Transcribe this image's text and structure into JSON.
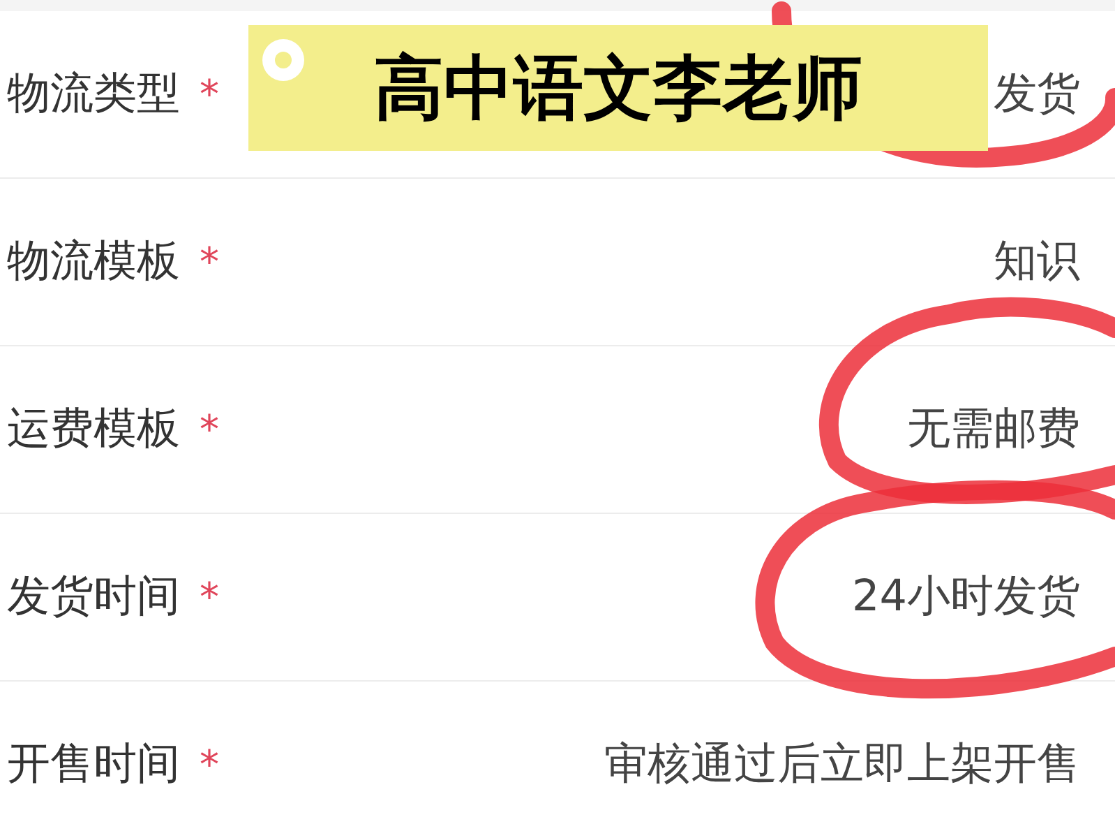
{
  "banner": {
    "text": "高中语文李老师"
  },
  "rows": [
    {
      "label": "物流类型",
      "required_mark": "*",
      "value": "发货"
    },
    {
      "label": "物流模板",
      "required_mark": "*",
      "value": "知识"
    },
    {
      "label": "运费模板",
      "required_mark": "*",
      "value": "无需邮费"
    },
    {
      "label": "发货时间",
      "required_mark": "*",
      "value": "24小时发货"
    },
    {
      "label": "开售时间",
      "required_mark": "*",
      "value": "审核通过后立即上架开售"
    }
  ]
}
